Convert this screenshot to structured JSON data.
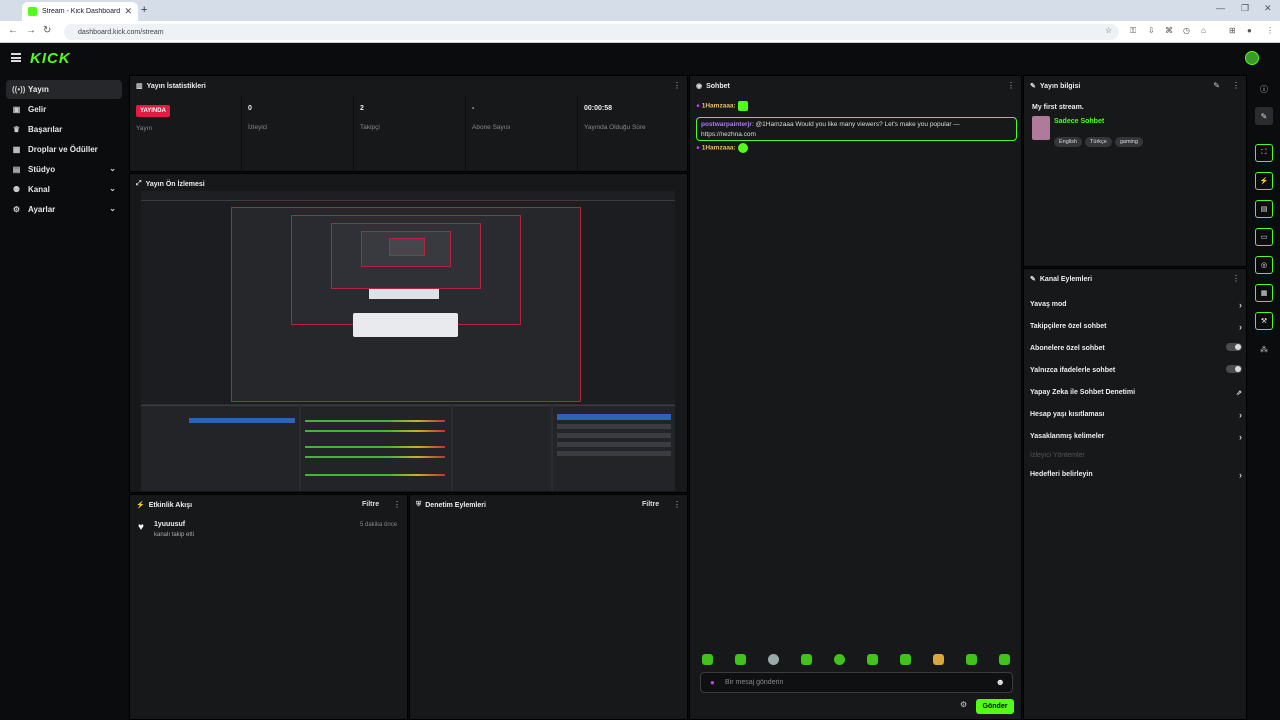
{
  "browser": {
    "tab_title": "Stream - Kick Dashboard",
    "url": "dashboard.kick.com/stream",
    "tab_close": "✕",
    "new_tab": "+"
  },
  "brand": {
    "logo": "KICK",
    "accent": "#53fc18"
  },
  "sidebar": {
    "items": [
      {
        "label": "Yayın",
        "icon": "broadcast-icon",
        "glyph": "((•))"
      },
      {
        "label": "Gelir",
        "icon": "wallet-icon",
        "glyph": "▣"
      },
      {
        "label": "Başarılar",
        "icon": "trophy-icon",
        "glyph": "♛"
      },
      {
        "label": "Droplar ve Ödüller",
        "icon": "gift-icon",
        "glyph": "▦"
      },
      {
        "label": "Stüdyo",
        "icon": "studio-icon",
        "glyph": "▤"
      },
      {
        "label": "Kanal",
        "icon": "users-icon",
        "glyph": "⚉"
      },
      {
        "label": "Ayarlar",
        "icon": "gear-icon",
        "glyph": "⚙"
      }
    ]
  },
  "stats": {
    "title": "Yayın İstatistikleri",
    "live_badge": "YAYINDA",
    "live_label": "Yayın",
    "viewers_value": "0",
    "viewers_label": "İzleyici",
    "followers_value": "2",
    "followers_label": "Takipçi",
    "subs_value": "-",
    "subs_label": "Abone Sayısı",
    "uptime_value": "00:00:58",
    "uptime_label": "Yayında Olduğu Süre"
  },
  "preview": {
    "title": "Yayın Ön İzlemesi"
  },
  "activity": {
    "title": "Etkinlik Akışı",
    "filter": "Filtre",
    "user": "1yuuusuf",
    "action": "kanalı takip etti",
    "time": "5 dakika önce"
  },
  "moderation": {
    "title": "Denetim Eylemleri",
    "filter": "Filtre"
  },
  "chat": {
    "title": "Sohbet",
    "messages": [
      {
        "user": "1Hamzaaa:"
      },
      {
        "user": "postwarpainterjr",
        "text": ": @1Hamzaaa Would you like many viewers? Let's make you popular — https://nezhna.com"
      },
      {
        "user": "1Hamzaaa:"
      }
    ],
    "input_placeholder": "Bir mesaj gönderin",
    "send_label": "Gönder"
  },
  "stream_info": {
    "title": "Yayın bilgisi",
    "stream_title": "My first stream.",
    "category": "Sadece Sohbet",
    "tags": [
      "English",
      "Türkçe",
      "gaming"
    ]
  },
  "channel_actions": {
    "title": "Kanal Eylemleri",
    "items": [
      {
        "label": "Yavaş mod",
        "control": "arrow"
      },
      {
        "label": "Takipçilere özel sohbet",
        "control": "arrow"
      },
      {
        "label": "Abonelere özel sohbet",
        "control": "toggle",
        "enabled": false
      },
      {
        "label": "Yalnızca ifadelerle sohbet",
        "control": "toggle",
        "enabled": false
      },
      {
        "label": "Yapay Zeka ile Sohbet Denetimi",
        "control": "external"
      },
      {
        "label": "Hesap yaşı kısıtlaması",
        "control": "arrow"
      },
      {
        "label": "Yasaklanmış kelimeler",
        "control": "arrow"
      },
      {
        "label": "İzleyici Yöntemler",
        "control": "none"
      },
      {
        "label": "Hedefleri belirleyin",
        "control": "arrow"
      }
    ]
  }
}
